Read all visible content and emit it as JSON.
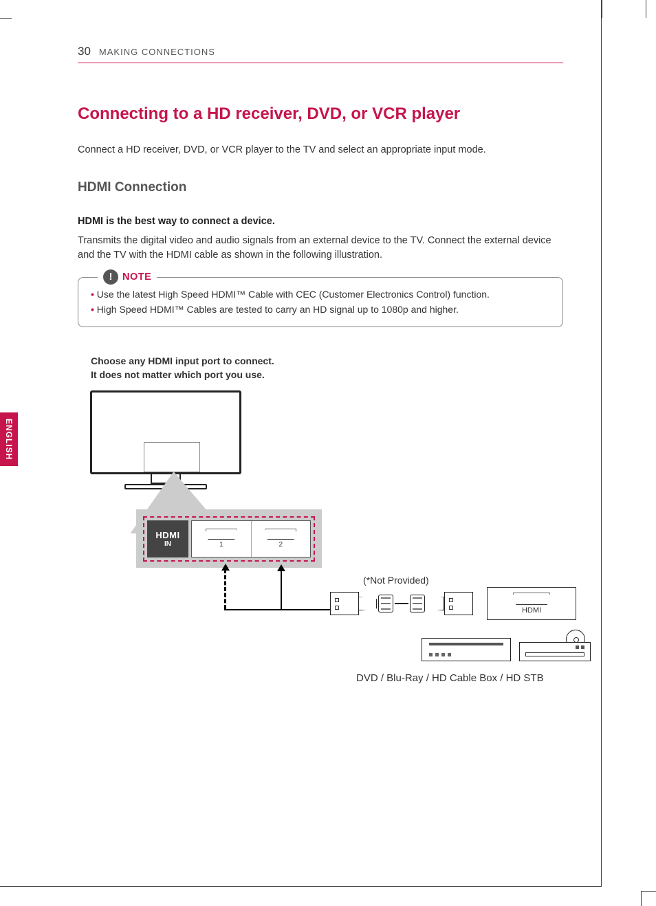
{
  "header": {
    "page_number": "30",
    "section": "MAKING CONNECTIONS"
  },
  "title": "Connecting to a HD receiver, DVD, or VCR player",
  "intro": "Connect a HD receiver, DVD, or VCR player to the TV and select an appropriate input mode.",
  "subheading": "HDMI Connection",
  "bold_line": "HDMI is the best way to connect a device.",
  "body": "Transmits the digital video and audio signals from an external device to the TV. Connect the external device and the TV with the HDMI cable as shown in the following illustration.",
  "note": {
    "label": "NOTE",
    "items": [
      "Use the latest High Speed HDMI™ Cable with CEC (Customer Electronics Control) function.",
      "High Speed HDMI™ Cables are tested to carry an HD signal up to 1080p and higher."
    ]
  },
  "diagram": {
    "caption_line1": "Choose any HDMI input port to connect.",
    "caption_line2": "It does not matter which port you use.",
    "hdmi_logo": "HDMI",
    "hdmi_in": "IN",
    "port1": "1",
    "port2": "2",
    "not_provided": "(*Not Provided)",
    "hdmi_out_label": "HDMI",
    "devices_label": "DVD / Blu-Ray / HD Cable Box / HD STB"
  },
  "language_tab": "ENGLISH"
}
